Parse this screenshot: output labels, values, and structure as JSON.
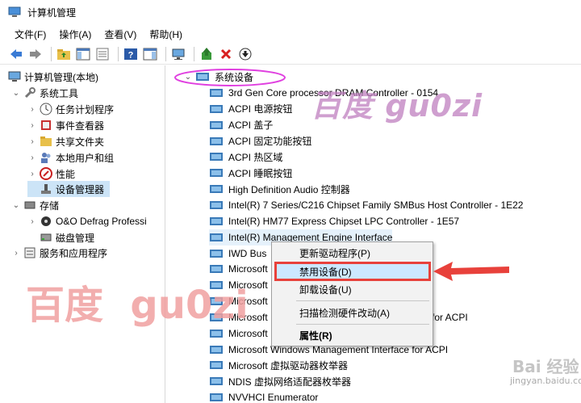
{
  "window": {
    "title": "计算机管理"
  },
  "menu": [
    "文件(F)",
    "操作(A)",
    "查看(V)",
    "帮助(H)"
  ],
  "toolbar_icons": [
    "back-icon",
    "forward-icon",
    "up-folder-icon",
    "show-tree-icon",
    "properties-icon",
    "help-icon",
    "show-action-icon",
    "monitor-icon",
    "update-driver-icon",
    "uninstall-icon",
    "disable-icon"
  ],
  "left_tree": {
    "root": "计算机管理(本地)",
    "system_tools": "系统工具",
    "task_scheduler": "任务计划程序",
    "event_viewer": "事件查看器",
    "shared_folders": "共享文件夹",
    "local_users": "本地用户和组",
    "performance": "性能",
    "device_manager": "设备管理器",
    "storage": "存储",
    "defrag": "O&O Defrag Professi",
    "disk_mgmt": "磁盘管理",
    "services": "服务和应用程序"
  },
  "device_tree": {
    "category": "系统设备",
    "devices": [
      "3rd Gen Core processor DRAM Controller - 0154",
      "ACPI 电源按钮",
      "ACPI 盖子",
      "ACPI 固定功能按钮",
      "ACPI 热区域",
      "ACPI 睡眠按钮",
      "High Definition Audio 控制器",
      "Intel(R) 7 Series/C216 Chipset Family SMBus Host Controller - 1E22",
      "Intel(R) HM77 Express Chipset LPC Controller - 1E57",
      "Intel(R) Management Engine Interface",
      "IWD Bus",
      "Microsoft",
      "Microsoft",
      "Microsoft",
      "Microsoft",
      "Microsoft",
      "Microsoft Windows Management Interface for ACPI",
      "Microsoft 虚拟驱动器枚举器",
      "NDIS 虚拟网络适配器枚举器",
      "NVVHCI Enumerator"
    ],
    "hidden_suffix": "for ACPI"
  },
  "context_menu": {
    "update": "更新驱动程序(P)",
    "disable": "禁用设备(D)",
    "uninstall": "卸载设备(U)",
    "scan": "扫描检测硬件改动(A)",
    "properties": "属性(R)"
  },
  "watermark": {
    "top": "百度 gu0zi",
    "left": "百度  gu0zi",
    "corner": "Bai 经验",
    "corner_url": "jingyan.baidu.com"
  },
  "colors": {
    "annotation_red": "#e8413b",
    "highlight_magenta": "#e040e0",
    "selection_blue": "#cce4f7",
    "watermark_pink": "#f0a0a0",
    "watermark_purple": "#c080c0"
  }
}
